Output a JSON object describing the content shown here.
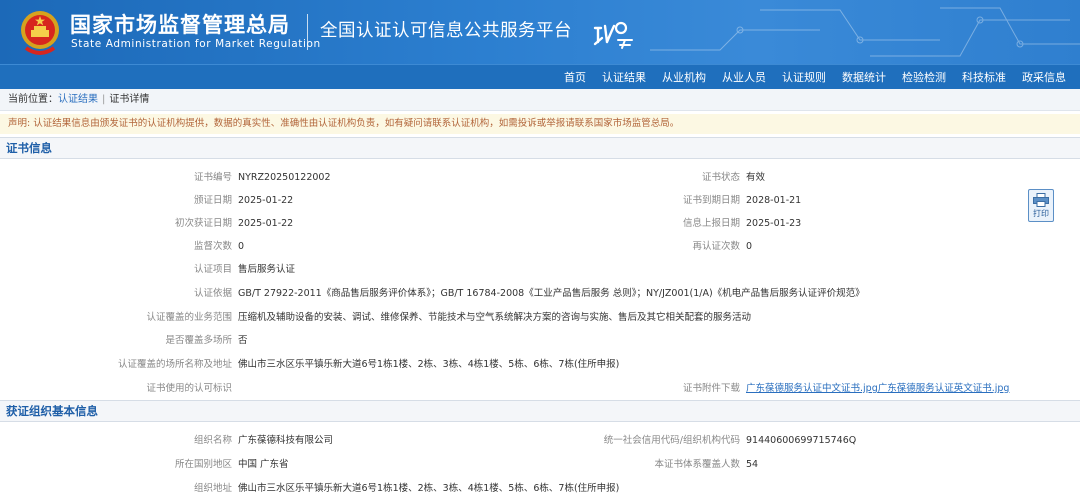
{
  "header": {
    "agency_cn": "国家市场监督管理总局",
    "agency_en": "State Administration  for  Market Regulation",
    "platform_title": "全国认证认可信息公共服务平台"
  },
  "nav": {
    "items": [
      "首页",
      "认证结果",
      "从业机构",
      "从业人员",
      "认证规则",
      "数据统计",
      "检验检测",
      "科技标准",
      "政采信息"
    ]
  },
  "breadcrumb": {
    "prefix": "当前位置：",
    "level1": "认证结果",
    "level2": "证书详情",
    "separator": "|"
  },
  "notice": "声明: 认证结果信息由颁发证书的认证机构提供，数据的真实性、准确性由认证机构负责，如有疑问请联系认证机构，如需投诉或举报请联系国家市场监管总局。",
  "print_label": "打印",
  "sections": {
    "certificate": {
      "title": "证书信息",
      "rows": [
        {
          "l_label": "证书编号",
          "l_value": "NYRZ20250122002",
          "r_label": "证书状态",
          "r_value": "有效"
        },
        {
          "l_label": "颁证日期",
          "l_value": "2025-01-22",
          "r_label": "证书到期日期",
          "r_value": "2028-01-21"
        },
        {
          "l_label": "初次获证日期",
          "l_value": "2025-01-22",
          "r_label": "信息上报日期",
          "r_value": "2025-01-23"
        },
        {
          "l_label": "监督次数",
          "l_value": "0",
          "r_label": "再认证次数",
          "r_value": "0"
        },
        {
          "l_label": "认证项目",
          "l_value": "售后服务认证"
        },
        {
          "l_label": "认证依据",
          "l_value": "GB/T 27922-2011《商品售后服务评价体系》；GB/T 16784-2008《工业产品售后服务 总则》；NY/JZ001(1/A)《机电产品售后服务认证评价规范》"
        },
        {
          "l_label": "认证覆盖的业务范围",
          "l_value": "压缩机及辅助设备的安装、调试、维修保养、节能技术与空气系统解决方案的咨询与实施、售后及其它相关配套的服务活动"
        },
        {
          "l_label": "是否覆盖多场所",
          "l_value": "否"
        },
        {
          "l_label": "认证覆盖的场所名称及地址",
          "l_value": "佛山市三水区乐平镇乐新大道6号1栋1楼、2栋、3栋、4栋1楼、5栋、6栋、7栋(住所申报)"
        },
        {
          "l_label": "证书使用的认可标识",
          "l_value": "",
          "r_label": "证书附件下载",
          "r_link1": "广东葆德服务认证中文证书.jpg",
          "r_link2": "广东葆德服务认证英文证书.jpg"
        }
      ]
    },
    "organization": {
      "title": "获证组织基本信息",
      "rows": [
        {
          "l_label": "组织名称",
          "l_value": "广东葆德科技有限公司",
          "r_label": "统一社会信用代码/组织机构代码",
          "r_value": "91440600699715746Q"
        },
        {
          "l_label": "所在国别地区",
          "l_value": "中国 广东省",
          "r_label": "本证书体系覆盖人数",
          "r_value": "54"
        },
        {
          "l_label": "组织地址",
          "l_value": "佛山市三水区乐平镇乐新大道6号1栋1楼、2栋、3栋、4栋1楼、5栋、6栋、7栋(住所申报)"
        }
      ]
    }
  },
  "colors": {
    "header_blue": "#2c7fd0",
    "nav_blue": "#1f6fbd",
    "section_title": "#1f5fa8",
    "link": "#2a6fbf",
    "notice_text": "#b2653a",
    "notice_bg": "#fcf8e3"
  }
}
